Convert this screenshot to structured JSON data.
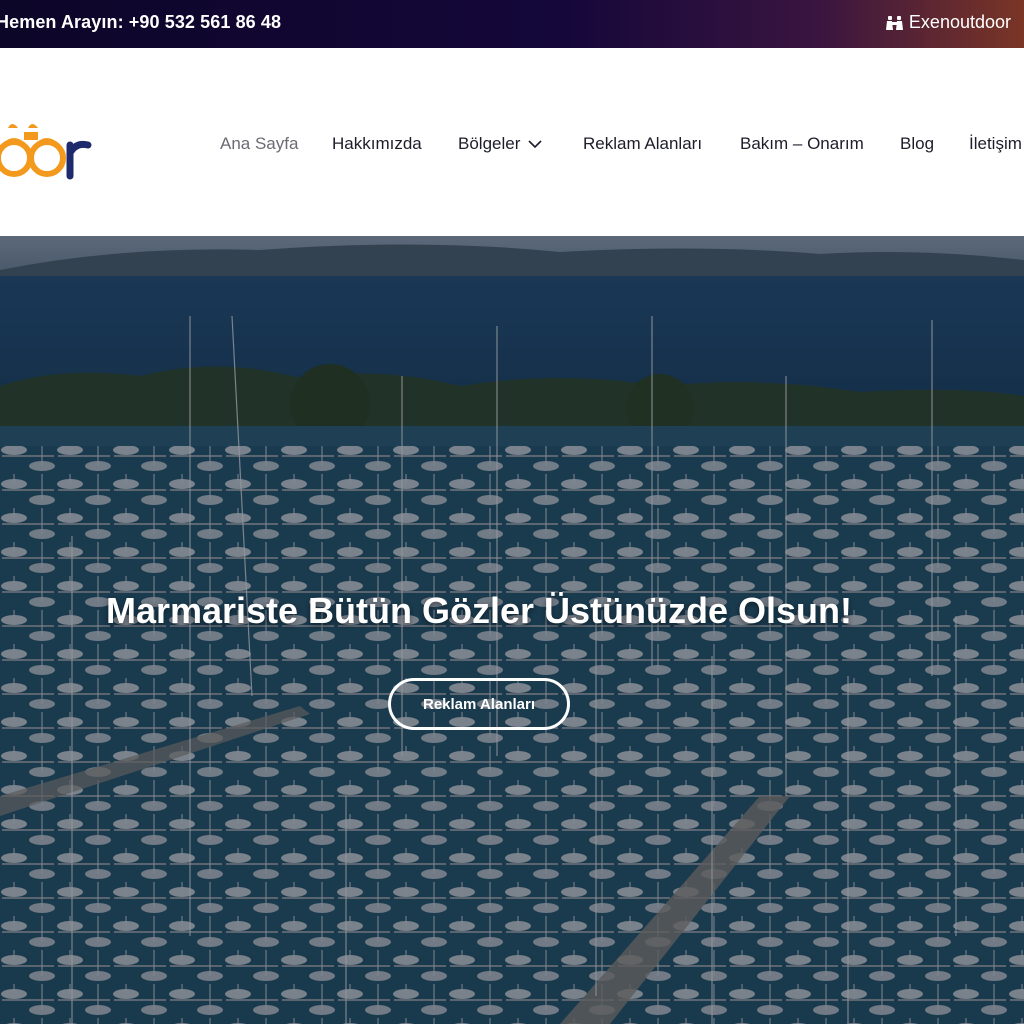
{
  "topbar": {
    "phone_text": "Hemen Arayın: +90 532 561 86 48",
    "brand_text": "Exenoutdoor",
    "brand_icon": "binoculars-icon"
  },
  "logo": {
    "visible_text": "oor",
    "icon": "binoculars-logo"
  },
  "nav": {
    "items": [
      {
        "label": "Ana Sayfa",
        "active": true
      },
      {
        "label": "Hakkımızda"
      },
      {
        "label": "Bölgeler",
        "dropdown": true
      },
      {
        "label": "Reklam Alanları"
      },
      {
        "label": "Bakım – Onarım"
      },
      {
        "label": "Blog"
      },
      {
        "label": "İletişim"
      }
    ]
  },
  "hero": {
    "title": "Marmariste Bütün Gözler Üstünüzde Olsun!",
    "button_label": "Reklam Alanları"
  },
  "colors": {
    "topbar_start": "#0c0628",
    "topbar_end": "#7a3526",
    "logo_orange": "#f39a1e",
    "logo_navy": "#1d2a6b",
    "nav_text": "#1d1d2b",
    "nav_active": "#6b6b75"
  }
}
